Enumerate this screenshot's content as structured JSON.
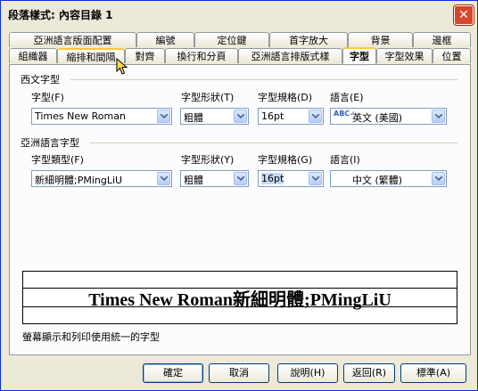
{
  "window": {
    "title": "段落樣式: 內容目錄 1",
    "close_glyph": "✕"
  },
  "tabs_back": [
    "亞洲語言版面配置",
    "編號",
    "定位鍵",
    "首字放大",
    "背景",
    "邊框"
  ],
  "tabs_front": [
    "組織器",
    "縮排和間隔",
    "對齊",
    "換行和分頁",
    "亞洲語言排版式樣",
    "字型",
    "字型效果",
    "位置"
  ],
  "western": {
    "section_label": "西文字型",
    "font_label": "字型(F)",
    "font_value": "Times New Roman",
    "style_label": "字型形狀(T)",
    "style_value": "粗體",
    "size_label": "字型規格(D)",
    "size_value": "16pt",
    "lang_label": "語言(E)",
    "lang_value": "英文 (美國)"
  },
  "asian": {
    "section_label": "亞洲語言字型",
    "font_label": "字型類型(F)",
    "font_value": "新細明體;PMingLiU",
    "style_label": "字型形狀(Y)",
    "style_value": "粗體",
    "size_label": "字型規格(G)",
    "size_value": "16pt",
    "lang_label": "語言(I)",
    "lang_value": "中文 (繁體)"
  },
  "preview_text": "Times New Roman新細明體;PMingLiU",
  "note": "螢幕顯示和列印使用統一的字型",
  "buttons": {
    "ok": "確定",
    "cancel": "取消",
    "help": "說明(H)",
    "reset": "返回(R)",
    "standard": "標準(A)"
  },
  "colors": {
    "accent": "#ffc83c",
    "close": "#d8472a",
    "border": "#7f9db9"
  }
}
